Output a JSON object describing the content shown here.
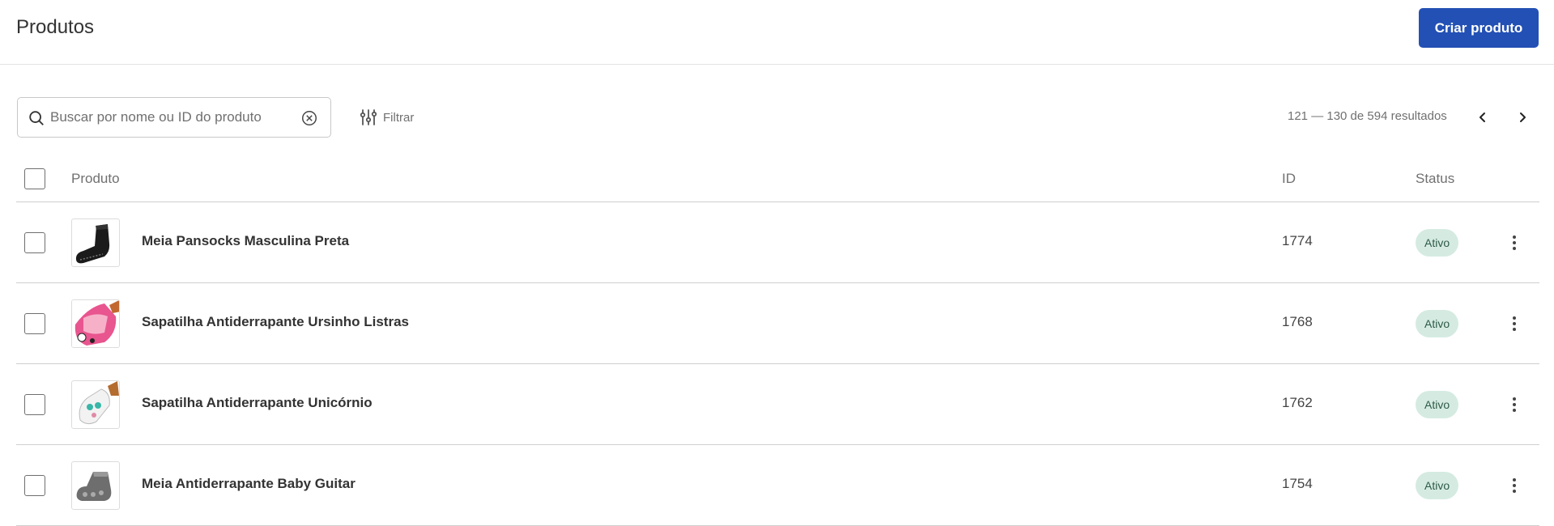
{
  "header": {
    "title": "Produtos",
    "create_label": "Criar produto",
    "accent_color": "#2350b4"
  },
  "toolbar": {
    "search_placeholder": "Buscar por nome ou ID do produto",
    "search_value": "",
    "filter_label": "Filtrar",
    "results_text": "121 — 130 de 594 resultados"
  },
  "table": {
    "columns": {
      "product": "Produto",
      "id": "ID",
      "status": "Status"
    },
    "rows": [
      {
        "name": "Meia Pansocks Masculina Preta",
        "id": "1774",
        "status": "Ativo",
        "thumb_icon": "black-sock-icon"
      },
      {
        "name": "Sapatilha Antiderrapante Ursinho Listras",
        "id": "1768",
        "status": "Ativo",
        "thumb_icon": "pink-slipper-icon"
      },
      {
        "name": "Sapatilha Antiderrapante Unicórnio",
        "id": "1762",
        "status": "Ativo",
        "thumb_icon": "unicorn-slipper-icon"
      },
      {
        "name": "Meia Antiderrapante Baby Guitar",
        "id": "1754",
        "status": "Ativo",
        "thumb_icon": "gray-sock-icon"
      }
    ]
  },
  "colors": {
    "status_bg": "#d5ebe2",
    "status_text": "#2e5a47",
    "border": "#cfcfcf"
  }
}
